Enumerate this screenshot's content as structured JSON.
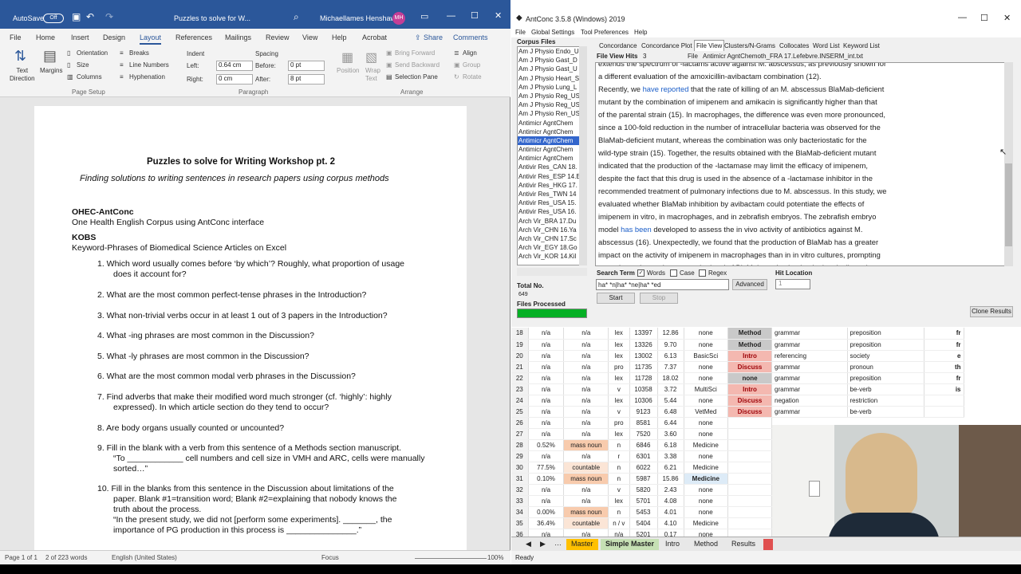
{
  "word": {
    "title": {
      "autosave": "AutoSave",
      "toggle": "Off",
      "doc": "Puzzles to solve for W...",
      "user": "Michaellames Henshaw",
      "initials": "MH"
    },
    "tabs": [
      "File",
      "Home",
      "Insert",
      "Design",
      "Layout",
      "References",
      "Mailings",
      "Review",
      "View",
      "Help",
      "Acrobat"
    ],
    "share": "Share",
    "comments": "Comments",
    "ribbon": {
      "text_direction": "Text\nDirection",
      "margins": "Margins",
      "orientation": "Orientation",
      "size": "Size",
      "columns": "Columns",
      "breaks": "Breaks",
      "line_numbers": "Line Numbers",
      "hyphenation": "Hyphenation",
      "indent": "Indent",
      "spacing": "Spacing",
      "left_label": "Left:",
      "left_val": "0.64 cm",
      "right_label": "Right:",
      "right_val": "0 cm",
      "before_label": "Before:",
      "before_val": "0 pt",
      "after_label": "After:",
      "after_val": "8 pt",
      "position": "Position",
      "wrap_text": "Wrap\nText",
      "bring_forward": "Bring Forward",
      "send_backward": "Send Backward",
      "selection_pane": "Selection Pane",
      "align": "Align",
      "group": "Group",
      "rotate": "Rotate",
      "g_page_setup": "Page Setup",
      "g_paragraph": "Paragraph",
      "g_arrange": "Arrange"
    },
    "doc": {
      "title": "Puzzles to solve for Writing Workshop pt. 2",
      "subtitle": "Finding solutions to writing sentences in research papers using corpus methods",
      "h1": "OHEC-AntConc",
      "p1": "One Health English Corpus using AntConc interface",
      "h2": "KOBS",
      "p2": "Keyword-Phrases of Biomedical Science Articles on Excel",
      "q1a": "1.   Which word usually comes before ‘by which’? Roughly, what proportion of usage",
      "q1b": "does it account for?",
      "q2": "2.   What are the most common perfect-tense phrases in the Introduction?",
      "q3": "3.   What non-trivial verbs occur in at least 1 out of 3 papers in the Introduction?",
      "q4": "4.   What -ing phrases are most common in the Discussion?",
      "q5": "5.   What -ly phrases are most common in the Discussion?",
      "q6": "6.   What are the most common modal verb phrases in the Discussion?",
      "q7a": "7.   Find adverbs that make their modified word much stronger (cf. ‘highly’: highly",
      "q7b": "expressed). In which article section do they tend to occur?",
      "q8": "8.   Are body organs usually counted or uncounted?",
      "q9a": "9.   Fill in the blank with a verb from this sentence of a Methods section manuscript.",
      "q9b": "“To ____________ cell numbers and cell size in VMH and ARC, cells were manually",
      "q9c": "sorted…”",
      "q10a": "10. Fill in the blanks from this sentence in the Discussion about limitations of the",
      "q10b": "paper. Blank #1=transition word; Blank #2=explaining that nobody knows the",
      "q10c": "truth about the process.",
      "q10d": "“In the present study, we did not [perform some experiments]. _______, the",
      "q10e": "importance of PG production in this process is _______________.”"
    },
    "status": {
      "page": "Page 1 of 1",
      "words": "2 of 223 words",
      "lang": "English (United States)",
      "focus": "Focus",
      "zoom": "100%"
    }
  },
  "antconc": {
    "title": "AntConc 3.5.8 (Windows) 2019",
    "menu": [
      "File",
      "Global Settings",
      "Tool Preferences",
      "Help"
    ],
    "corpus_label": "Corpus Files",
    "corpus": [
      "Am J Physio Endo_U",
      "Am J Physio Gast_D",
      "Am J Physio Gast_U",
      "Am J Physio Heart_S",
      "Am J Physio Lung_L",
      "Am J Physio Reg_US",
      "Am J Physio Reg_US",
      "Am J Physio Ren_US",
      "Antimicr AgntChem",
      "Antimicr AgntChem",
      "Antimicr AgntChem",
      "Antimicr AgntChem",
      "Antimicr AgntChem",
      "Antivir Res_CAN 18.",
      "Antivir Res_ESP 14.E",
      "Antivir Res_HKG 17.",
      "Antivir Res_TWN 14",
      "Antivir Res_USA 15.",
      "Antivir Res_USA 16.",
      "Arch Vir_BRA 17.Du",
      "Arch Vir_CHN 16.Ya",
      "Arch Vir_CHN 17.Sc",
      "Arch Vir_EGY 18.Go",
      "Arch Vir_KOR 14.Kil"
    ],
    "selected_index": 10,
    "tabs": [
      "Concordance",
      "Concordance Plot",
      "File View",
      "Clusters/N-Grams",
      "Collocates",
      "Word List",
      "Keyword List"
    ],
    "hits_label": "File View Hits",
    "hits": "3",
    "file_label": "File",
    "file": "Antimicr AgntChemoth_FRA 17.Lefebvre.INSERM_int.txt",
    "text": [
      {
        "a": "extends the spectrum of    -lactams active against M. abscessus, as previously shown for",
        "h": "",
        "b": ""
      },
      {
        "a": "a different evaluation of the amoxicillin-avibactam combination (12).",
        "h": "",
        "b": ""
      },
      {
        "a": "Recently, we ",
        "h": "have reported",
        "b": " that the rate of killing of an M. abscessus BlaMab-deficient"
      },
      {
        "a": "mutant by the combination of imipenem and amikacin is significantly higher than that",
        "h": "",
        "b": ""
      },
      {
        "a": "of the parental strain (15). In macrophages, the difference was even more pronounced,",
        "h": "",
        "b": ""
      },
      {
        "a": "since a 100-fold reduction in the number of intracellular bacteria was observed for the",
        "h": "",
        "b": ""
      },
      {
        "a": "BlaMab-deficient mutant, whereas the combination was only bacteriostatic for the",
        "h": "",
        "b": ""
      },
      {
        "a": "wild-type strain (15). Together, the results obtained with the BlaMab-deficient mutant",
        "h": "",
        "b": ""
      },
      {
        "a": "indicated that the production of the    -lactamase may limit the efficacy of imipenem,",
        "h": "",
        "b": ""
      },
      {
        "a": "despite the fact that this drug is used in the absence of a    -lactamase inhibitor in the",
        "h": "",
        "b": ""
      },
      {
        "a": "recommended treatment of pulmonary infections due to M. abscessus. In this study, we",
        "h": "",
        "b": ""
      },
      {
        "a": "evaluated whether BlaMab inhibition by avibactam could potentiate the effects of",
        "h": "",
        "b": ""
      },
      {
        "a": "imipenem in vitro, in macrophages, and in zebrafish embryos. The zebrafish embryo",
        "h": "",
        "b": ""
      },
      {
        "a": "model ",
        "h": "has been",
        "b": " developed to assess the in vivo activity of antibiotics against M."
      },
      {
        "a": "abscessus (16). Unexpectedly, we found that the production of BlaMab has a greater",
        "h": "",
        "b": ""
      },
      {
        "a": "impact on the activity of imipenem in macrophages than in in vitro cultures, prompting",
        "h": "",
        "b": ""
      },
      {
        "a": "us to determine and compare the level of BlaMab production in planktonically and",
        "h": "",
        "b": ""
      }
    ],
    "total_label": "Total No.",
    "total": "649",
    "processed_label": "Files Processed",
    "search_label": "Search Term",
    "opt_words": "Words",
    "opt_case": "Case",
    "opt_regex": "Regex",
    "search_value": "ha* *n|ha* *ne|ha* *ed",
    "advanced": "Advanced",
    "hitloc_label": "Hit Location",
    "hitloc": "1",
    "start": "Start",
    "stop": "Stop",
    "clone": "Clone Results"
  },
  "excel": {
    "rows": [
      [
        "18",
        "n/a",
        "n/a",
        "lex",
        "13397",
        "12.86",
        "none",
        "Method"
      ],
      [
        "19",
        "n/a",
        "n/a",
        "lex",
        "13326",
        "9.70",
        "none",
        "Method"
      ],
      [
        "20",
        "n/a",
        "n/a",
        "lex",
        "13002",
        "6.13",
        "BasicSci",
        "Intro"
      ],
      [
        "21",
        "n/a",
        "n/a",
        "pro",
        "11735",
        "7.37",
        "none",
        "Discuss"
      ],
      [
        "22",
        "n/a",
        "n/a",
        "lex",
        "11728",
        "18.02",
        "none",
        "none"
      ],
      [
        "23",
        "n/a",
        "n/a",
        "v",
        "10358",
        "3.72",
        "MultiSci",
        "Intro"
      ],
      [
        "24",
        "n/a",
        "n/a",
        "lex",
        "10306",
        "5.44",
        "none",
        "Discuss"
      ],
      [
        "25",
        "n/a",
        "n/a",
        "v",
        "9123",
        "6.48",
        "VetMed",
        "Discuss"
      ],
      [
        "26",
        "n/a",
        "n/a",
        "pro",
        "8581",
        "6.44",
        "none",
        ""
      ],
      [
        "27",
        "n/a",
        "n/a",
        "lex",
        "7520",
        "3.60",
        "none",
        ""
      ],
      [
        "28",
        "0.52%",
        "mass noun",
        "n",
        "6846",
        "6.18",
        "Medicine",
        ""
      ],
      [
        "29",
        "n/a",
        "n/a",
        "r",
        "6301",
        "3.38",
        "none",
        ""
      ],
      [
        "30",
        "77.5%",
        "countable",
        "n",
        "6022",
        "6.21",
        "Medicine",
        ""
      ],
      [
        "31",
        "0.10%",
        "mass noun",
        "n",
        "5987",
        "15.86",
        "Medicine",
        ""
      ],
      [
        "32",
        "n/a",
        "n/a",
        "v",
        "5820",
        "2.43",
        "none",
        ""
      ],
      [
        "33",
        "n/a",
        "n/a",
        "lex",
        "5701",
        "4.08",
        "none",
        ""
      ],
      [
        "34",
        "0.00%",
        "mass noun",
        "n",
        "5453",
        "4.01",
        "none",
        ""
      ],
      [
        "35",
        "36.4%",
        "countable",
        "n / v",
        "5404",
        "4.10",
        "Medicine",
        ""
      ],
      [
        "36",
        "n/a",
        "n/a",
        "n/a",
        "5201",
        "0.17",
        "none",
        ""
      ]
    ],
    "right_rows": [
      [
        "grammar",
        "preposition",
        "fr"
      ],
      [
        "grammar",
        "preposition",
        "fr"
      ],
      [
        "referencing",
        "society",
        "e"
      ],
      [
        "grammar",
        "pronoun",
        "th"
      ],
      [
        "grammar",
        "preposition",
        "fr"
      ],
      [
        "grammar",
        "be-verb",
        "is"
      ],
      [
        "negation",
        "restriction",
        ""
      ],
      [
        "grammar",
        "be-verb",
        ""
      ]
    ],
    "sheets": [
      "Master",
      "Simple Master",
      "Intro",
      "Method",
      "Results"
    ],
    "status": "Ready"
  },
  "colors": {
    "word_blue": "#2b579a",
    "method": "#c9c9c9",
    "intro": "#f4b8b0",
    "discuss": "#f4b8b0",
    "mass_noun": "#f8cbad",
    "countable": "#fbe5d6",
    "medicine_hi": "#ddebf7",
    "sheet_tab": "#ffc000",
    "sheet_tab2": "#c6e0b4"
  }
}
